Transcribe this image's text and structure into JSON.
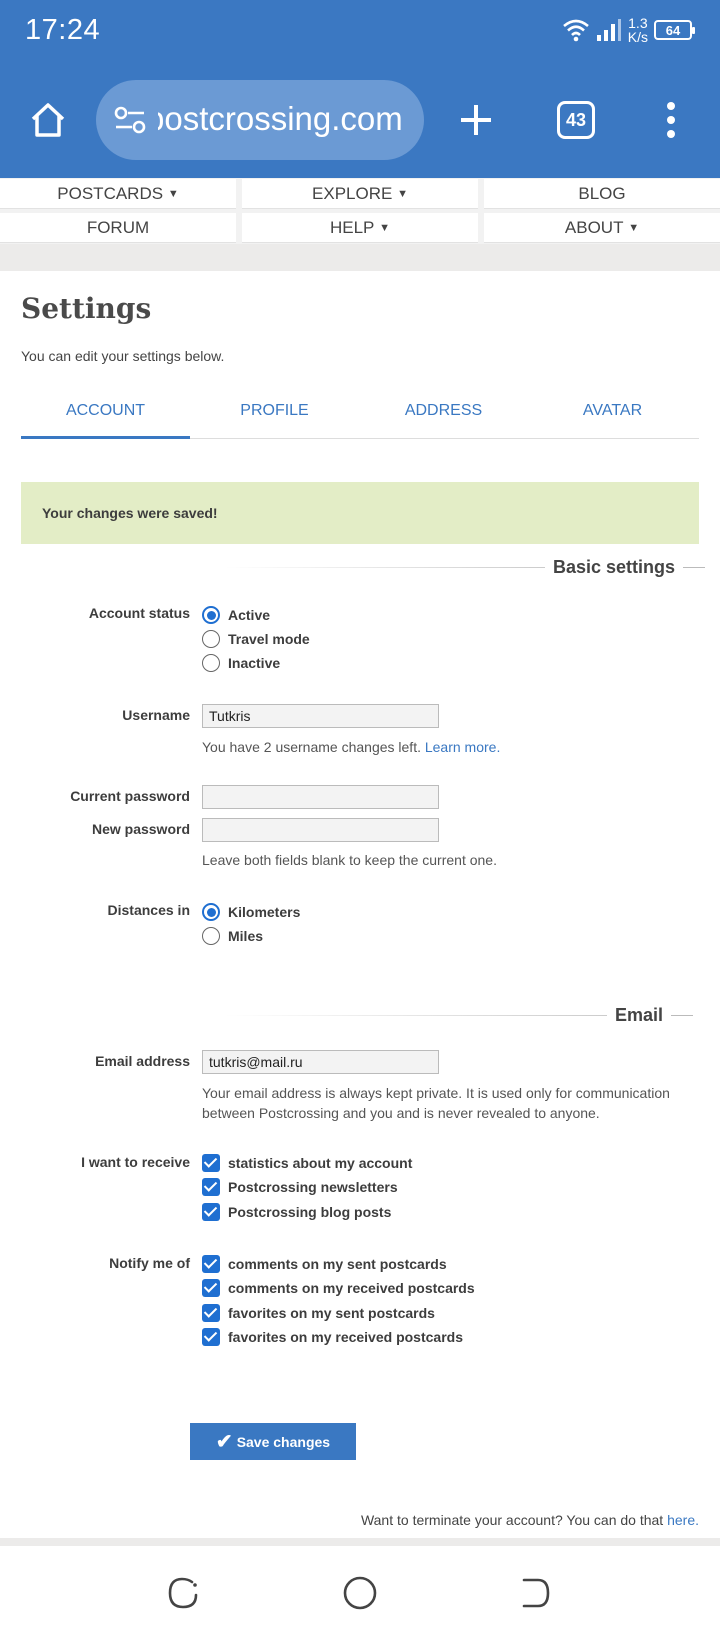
{
  "status_bar": {
    "time": "17:24",
    "speed_top": "1.3",
    "speed_bottom": "K/s",
    "battery": "64"
  },
  "browser": {
    "url": "postcrossing.com",
    "tab_count": "43"
  },
  "nav": {
    "items": [
      {
        "label": "POSTCARDS",
        "dropdown": "▼"
      },
      {
        "label": "EXPLORE",
        "dropdown": "▼"
      },
      {
        "label": "BLOG",
        "dropdown": ""
      },
      {
        "label": "FORUM",
        "dropdown": ""
      },
      {
        "label": "HELP",
        "dropdown": "▼"
      },
      {
        "label": "ABOUT",
        "dropdown": "▼"
      }
    ]
  },
  "page": {
    "title": "Settings",
    "subtitle": "You can edit your settings below.",
    "tabs": [
      {
        "label": "ACCOUNT",
        "active": true
      },
      {
        "label": "PROFILE",
        "active": false
      },
      {
        "label": "ADDRESS",
        "active": false
      },
      {
        "label": "AVATAR",
        "active": false
      }
    ],
    "notice": "Your changes were saved!"
  },
  "basic": {
    "heading": "Basic settings",
    "account_status_label": "Account status",
    "account_status_options": [
      "Active",
      "Travel mode",
      "Inactive"
    ],
    "account_status_selected": "Active",
    "username_label": "Username",
    "username_value": "Tutkris",
    "username_hint": "You have 2 username changes left.",
    "username_hint_link": "Learn more.",
    "current_password_label": "Current password",
    "new_password_label": "New password",
    "password_hint": "Leave both fields blank to keep the current one.",
    "distances_label": "Distances in",
    "distances_options": [
      "Kilometers",
      "Miles"
    ],
    "distances_selected": "Kilometers"
  },
  "email": {
    "heading": "Email",
    "address_label": "Email address",
    "address_value": "tutkris@mail.ru",
    "hint_line1": "Your email address is always kept private. It is used only for communication",
    "hint_line2": "between Postcrossing and you and is never revealed to anyone.",
    "receive_label": "I want to receive",
    "receive_options": [
      "statistics about my account",
      "Postcrossing newsletters",
      "Postcrossing blog posts"
    ],
    "notify_label": "Notify me of",
    "notify_options": [
      "comments on my sent postcards",
      "comments on my received postcards",
      "favorites on my sent postcards",
      "favorites on my received postcards"
    ]
  },
  "actions": {
    "save_label": "Save changes",
    "terminate_text": "Want to terminate your account? You can do that",
    "terminate_link": "here."
  },
  "colors": {
    "brand_blue": "#3b78c2",
    "notice_bg": "#e3edc6",
    "link": "#3a78c2"
  }
}
